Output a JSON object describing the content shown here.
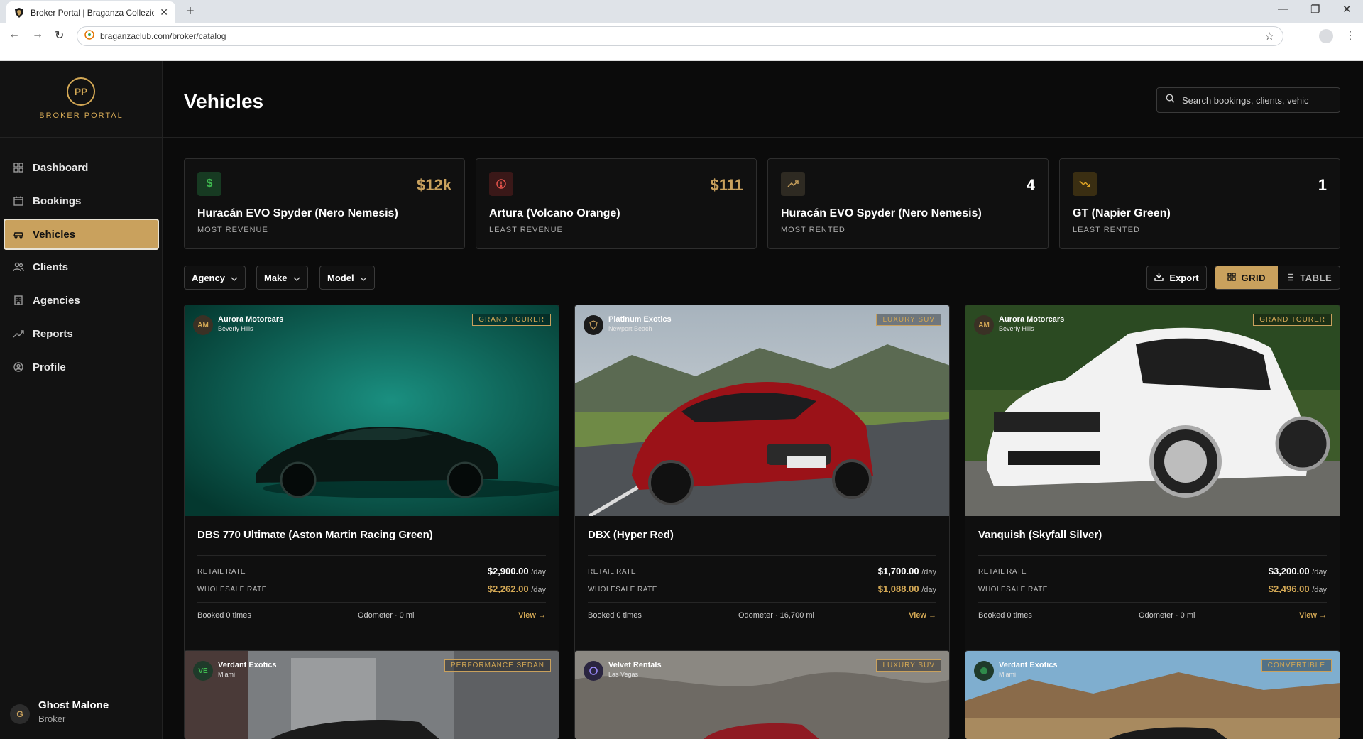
{
  "browser": {
    "tab_title": "Broker Portal | Braganza Collezione",
    "url": "braganzaclub.com/broker/catalog"
  },
  "sidebar": {
    "logo_initials": "PP",
    "logo_text": "BROKER PORTAL",
    "items": [
      {
        "label": "Dashboard",
        "icon": "grid-icon"
      },
      {
        "label": "Bookings",
        "icon": "calendar-icon"
      },
      {
        "label": "Vehicles",
        "icon": "car-icon",
        "active": true
      },
      {
        "label": "Clients",
        "icon": "users-icon"
      },
      {
        "label": "Agencies",
        "icon": "building-icon"
      },
      {
        "label": "Reports",
        "icon": "trend-icon"
      },
      {
        "label": "Profile",
        "icon": "user-circle-icon"
      }
    ],
    "user": {
      "initial": "G",
      "name": "Ghost Malone",
      "role": "Broker"
    }
  },
  "header": {
    "title": "Vehicles",
    "search_placeholder": "Search bookings, clients, vehic"
  },
  "stats": [
    {
      "icon": "dollar-icon",
      "value": "$12k",
      "name": "Huracán EVO Spyder (Nero Nemesis)",
      "label": "MOST REVENUE",
      "color": "#3fb950"
    },
    {
      "icon": "alert-icon",
      "value": "$111",
      "name": "Artura (Volcano Orange)",
      "label": "LEAST REVENUE",
      "color": "#e5534b"
    },
    {
      "icon": "trend-up-icon",
      "value": "4",
      "name": "Huracán EVO Spyder (Nero Nemesis)",
      "label": "MOST RENTED",
      "color": "#c9a15d"
    },
    {
      "icon": "trend-down-icon",
      "value": "1",
      "name": "GT (Napier Green)",
      "label": "LEAST RENTED",
      "color": "#e0a526"
    }
  ],
  "filters": [
    "Agency",
    "Make",
    "Model"
  ],
  "toolbar": {
    "export_label": "Export",
    "grid_label": "GRID",
    "table_label": "TABLE"
  },
  "labels": {
    "retail": "RETAIL RATE",
    "wholesale": "WHOLESALE RATE",
    "per_day": "/day",
    "view": "View →"
  },
  "vehicles": [
    {
      "agency_initials": "AM",
      "agency": "Aurora Motorcars",
      "location": "Beverly Hills",
      "category": "GRAND TOURER",
      "name": "DBS 770 Ultimate (Aston Martin Racing Green)",
      "retail": "$2,900.00",
      "wholesale": "$2,262.00",
      "booked": "Booked 0 times",
      "odometer": "Odometer · 0 mi"
    },
    {
      "agency_initials": "",
      "agency": "Platinum Exotics",
      "location": "Newport Beach",
      "category": "LUXURY SUV",
      "name": "DBX (Hyper Red)",
      "retail": "$1,700.00",
      "wholesale": "$1,088.00",
      "booked": "Booked 0 times",
      "odometer": "Odometer · 16,700 mi"
    },
    {
      "agency_initials": "AM",
      "agency": "Aurora Motorcars",
      "location": "Beverly Hills",
      "category": "GRAND TOURER",
      "name": "Vanquish (Skyfall Silver)",
      "retail": "$3,200.00",
      "wholesale": "$2,496.00",
      "booked": "Booked 0 times",
      "odometer": "Odometer · 0 mi"
    },
    {
      "agency_initials": "VE",
      "agency": "Verdant Exotics",
      "location": "Miami",
      "category": "PERFORMANCE SEDAN"
    },
    {
      "agency_initials": "",
      "agency": "Velvet Rentals",
      "location": "Las Vegas",
      "category": "LUXURY SUV"
    },
    {
      "agency_initials": "",
      "agency": "Verdant Exotics",
      "location": "Miami",
      "category": "CONVERTIBLE"
    }
  ]
}
